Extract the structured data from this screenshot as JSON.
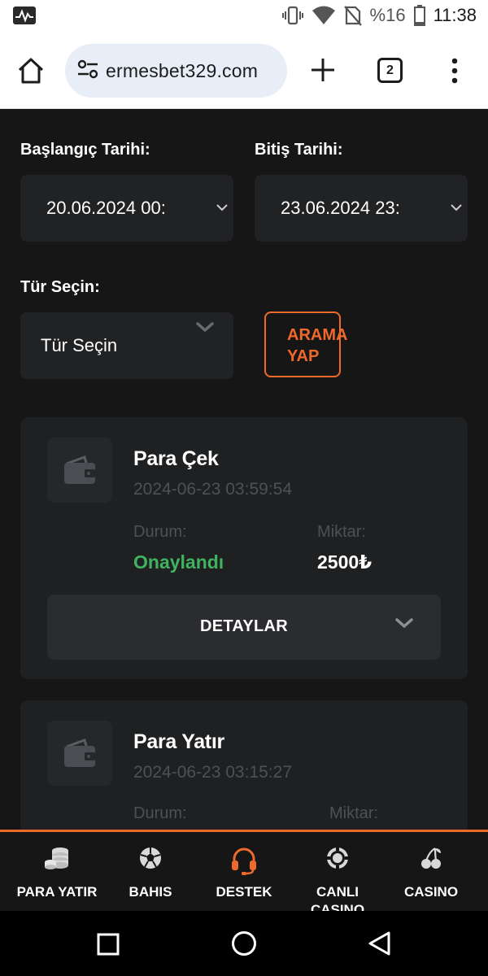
{
  "status_bar": {
    "battery_percent": "%16",
    "time": "11:38"
  },
  "browser": {
    "url": "ermesbet329.com",
    "tab_count": "2"
  },
  "filters": {
    "start_date_label": "Başlangıç Tarihi:",
    "start_date_value": "20.06.2024 00:",
    "end_date_label": "Bitiş Tarihi:",
    "end_date_value": "23.06.2024 23:",
    "type_label": "Tür Seçin:",
    "type_value": "Tür Seçin",
    "search_button_line1": "ARAMA",
    "search_button_line2": "YAP"
  },
  "transactions": [
    {
      "title": "Para Çek",
      "datetime": "2024-06-23 03:59:54",
      "status_label": "Durum:",
      "status": "Onaylandı",
      "amount_label": "Miktar:",
      "amount": "2500₺",
      "details_label": "DETAYLAR"
    },
    {
      "title": "Para Yatır",
      "datetime": "2024-06-23 03:15:27",
      "status_label": "Durum:",
      "amount_label": "Miktar:"
    }
  ],
  "bottom_nav": [
    {
      "label": "PARA YATIR",
      "icon": "coins-icon"
    },
    {
      "label": "BAHIS",
      "icon": "football-icon"
    },
    {
      "label": "DESTEK",
      "icon": "headset-icon",
      "active": true
    },
    {
      "label": "CANLI CASINO",
      "icon": "casino-chip-icon"
    },
    {
      "label": "CASINO",
      "icon": "cherries-icon"
    }
  ],
  "colors": {
    "accent": "#f0692a",
    "success": "#3fb35f",
    "background": "#161617",
    "card": "#1f2022"
  }
}
